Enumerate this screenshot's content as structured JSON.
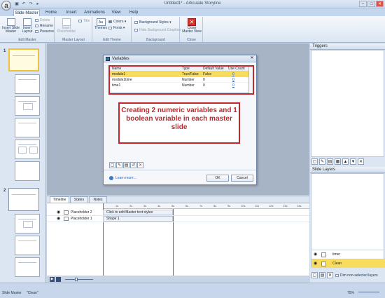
{
  "window": {
    "title": "Untitled1* - Articulate Storyline",
    "logo_letter": "a",
    "qat_icons": [
      "save-icon",
      "undo-icon",
      "redo-icon",
      "preview-icon"
    ],
    "qat_glyphs": [
      "▣",
      "↶",
      "↷",
      "▸"
    ],
    "min": "–",
    "max": "□",
    "close": "✕"
  },
  "tabs": [
    {
      "label": "Slide Master",
      "active": true
    },
    {
      "label": "Home"
    },
    {
      "label": "Insert"
    },
    {
      "label": "Animations"
    },
    {
      "label": "View"
    },
    {
      "label": "Help"
    }
  ],
  "ribbon": {
    "edit_master": {
      "label": "Edit Master",
      "insert_slide_master": "Insert Slide Master",
      "insert_layout": "Insert Layout",
      "delete": "Delete",
      "rename": "Rename",
      "preserve": "Preserve"
    },
    "master_layout": {
      "label": "Master Layout",
      "insert_placeholder": "Insert Placeholder",
      "title": "Title"
    },
    "edit_theme": {
      "label": "Edit Theme",
      "themes": "Themes",
      "colors": "Colors",
      "fonts": "Fonts"
    },
    "background": {
      "label": "Background",
      "background_styles": "Background Styles",
      "hide_background_graphics": "Hide Background Graphics"
    },
    "close": {
      "label": "Close",
      "close_master_view": "Close Master View"
    }
  },
  "thumbnails": {
    "numbers": [
      "1",
      "2"
    ]
  },
  "variables_dialog": {
    "title": "Variables",
    "columns": [
      "Name",
      "Type",
      "Default Value",
      "Use Count"
    ],
    "rows": [
      {
        "name": "module1",
        "type": "True/False",
        "default": "False",
        "use": "0",
        "selected": true
      },
      {
        "name": "module1time",
        "type": "Number",
        "default": "0",
        "use": "0"
      },
      {
        "name": "time1",
        "type": "Number",
        "default": "0",
        "use": "0"
      }
    ],
    "learn_more": "Learn more...",
    "ok": "OK",
    "cancel": "Cancel",
    "tool_icons": [
      "new-variable-icon",
      "edit-variable-icon",
      "copy-variable-icon",
      "rename-variable-icon",
      "delete-variable-icon"
    ],
    "tool_glyphs": [
      "▢",
      "✎",
      "▤",
      "↺",
      "✕"
    ]
  },
  "annotation": {
    "text": "Creating 2 numeric variables and 1 boolean variable in each master slide"
  },
  "timeline": {
    "tabs": [
      "Timeline",
      "States",
      "Notes"
    ],
    "ruler_ticks": [
      "1s",
      "2s",
      "3s",
      "4s",
      "5s",
      "6s",
      "7s",
      "8s",
      "9s",
      "10s",
      "11s",
      "12s",
      "13s",
      "14s"
    ],
    "rows": [
      {
        "label": "Placeholder 2",
        "bar": "Click to edit Master text styles"
      },
      {
        "label": "Placeholder 1",
        "bar": "Shape 1"
      }
    ]
  },
  "triggers": {
    "title": "Triggers",
    "tool_glyphs": [
      "▢",
      "✎",
      "▤",
      "▦",
      "▲",
      "▼",
      "✕"
    ]
  },
  "slide_layers": {
    "title": "Slide Layers",
    "layers": [
      {
        "name": "timer",
        "selected": false
      },
      {
        "name": "Clean",
        "selected": true
      }
    ],
    "dim_label": "Dim non-selected layers"
  },
  "status": {
    "mode": "Slide Master",
    "theme": "\"Clean\"",
    "zoom": "75%"
  },
  "colors": {
    "accent_red": "#c0282e",
    "selection_yellow": "#f7dc5e"
  }
}
